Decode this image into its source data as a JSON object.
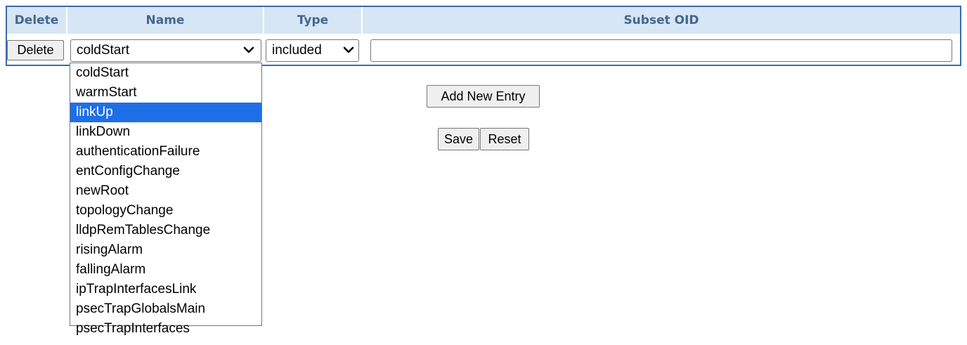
{
  "table": {
    "headers": {
      "delete": "Delete",
      "name": "Name",
      "type": "Type",
      "subset_oid": "Subset OID"
    },
    "row": {
      "delete_label": "Delete",
      "name_value": "coldStart",
      "type_value": "included",
      "subset_oid_value": ""
    }
  },
  "name_dropdown": {
    "options": [
      "coldStart",
      "warmStart",
      "linkUp",
      "linkDown",
      "authenticationFailure",
      "entConfigChange",
      "newRoot",
      "topologyChange",
      "lldpRemTablesChange",
      "risingAlarm",
      "fallingAlarm",
      "ipTrapInterfacesLink",
      "psecTrapGlobalsMain",
      "psecTrapInterfaces"
    ],
    "highlighted": "linkUp"
  },
  "actions": {
    "add_new_entry": "Add New Entry",
    "save": "Save",
    "reset": "Reset"
  },
  "colors": {
    "header_bg": "#d6e6f5",
    "header_text": "#45668f",
    "table_border": "#3b6aa8",
    "highlight": "#1e6fe6"
  },
  "icons": {
    "select_chevron": "chevron-down-icon"
  }
}
